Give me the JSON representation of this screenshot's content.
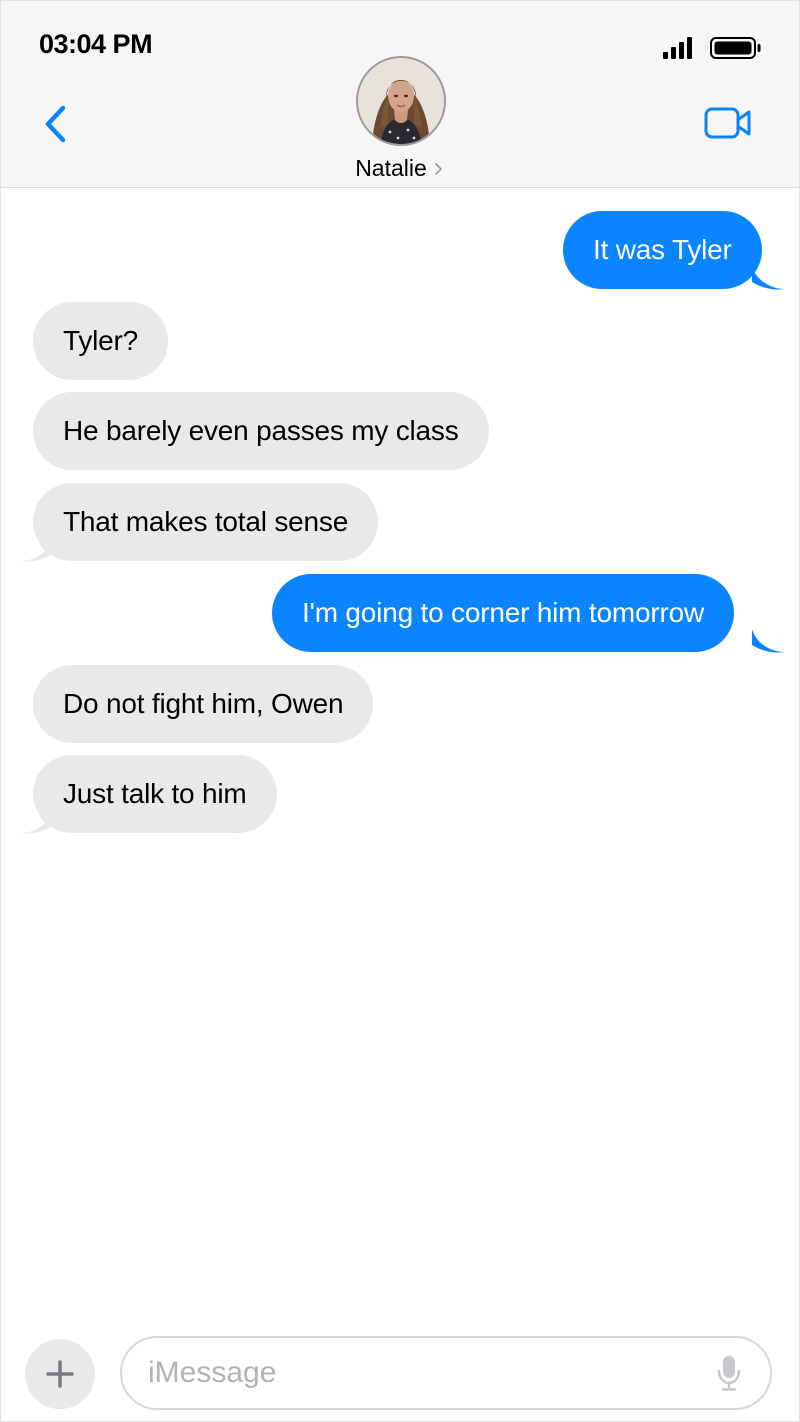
{
  "status_bar": {
    "time": "03:04 PM",
    "icons": [
      "signal-bars-icon",
      "battery-icon"
    ]
  },
  "header": {
    "back_icon": "chevron-left-icon",
    "contact_name": "Natalie",
    "contact_chevron_icon": "chevron-right-icon",
    "video_icon": "video-camera-icon",
    "accent_color": "#0a84ff"
  },
  "messages": [
    {
      "direction": "outgoing",
      "text": "It was Tyler"
    },
    {
      "direction": "incoming",
      "text": "Tyler?"
    },
    {
      "direction": "incoming",
      "text": "He barely even passes my class"
    },
    {
      "direction": "incoming",
      "text": "That makes total sense"
    },
    {
      "direction": "outgoing",
      "text": "I'm going to corner him tomorrow"
    },
    {
      "direction": "incoming",
      "text": "Do not fight him, Owen"
    },
    {
      "direction": "incoming",
      "text": "Just talk to him"
    }
  ],
  "composer": {
    "placeholder": "iMessage",
    "plus_icon": "plus-icon",
    "mic_icon": "microphone-icon"
  },
  "colors": {
    "outgoing_bubble": "#0a84ff",
    "incoming_bubble": "#e9e9eb",
    "header_background": "#f6f6f6"
  }
}
